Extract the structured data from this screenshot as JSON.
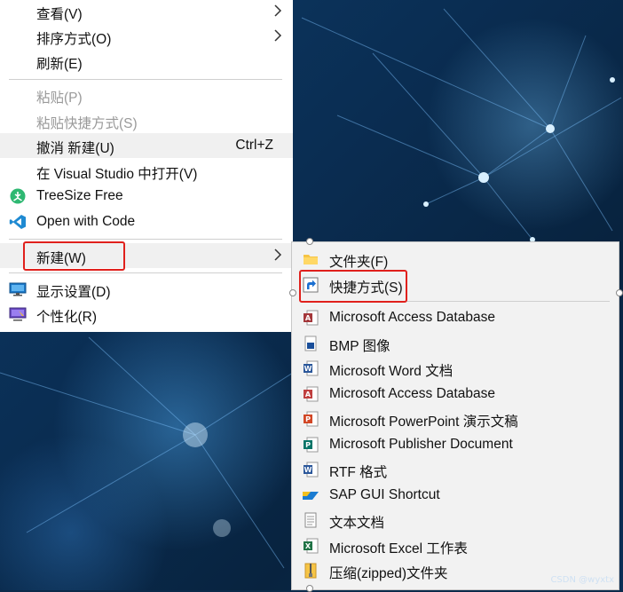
{
  "main_menu": {
    "items": [
      {
        "label": "查看(V)"
      },
      {
        "label": "排序方式(O)"
      },
      {
        "label": "刷新(E)"
      },
      {
        "label": "粘贴(P)"
      },
      {
        "label": "粘贴快捷方式(S)"
      },
      {
        "label": "撤消 新建(U)",
        "shortcut": "Ctrl+Z"
      },
      {
        "label": "在 Visual Studio 中打开(V)"
      },
      {
        "label": "TreeSize Free",
        "icon": "treesize-icon"
      },
      {
        "label": "Open with Code",
        "icon": "vscode-icon"
      },
      {
        "label": "新建(W)"
      },
      {
        "label": "显示设置(D)",
        "icon": "display-icon"
      },
      {
        "label": "个性化(R)",
        "icon": "personalize-icon"
      }
    ]
  },
  "new_submenu": {
    "items": [
      {
        "label": "文件夹(F)",
        "icon": "folder-icon"
      },
      {
        "label": "快捷方式(S)",
        "icon": "shortcut-icon"
      },
      {
        "label": "Microsoft Access Database",
        "icon": "access-icon"
      },
      {
        "label": "BMP 图像",
        "icon": "bmp-icon"
      },
      {
        "label": "Microsoft Word 文档",
        "icon": "word-icon"
      },
      {
        "label": "Microsoft Access Database",
        "icon": "access-icon"
      },
      {
        "label": "Microsoft PowerPoint 演示文稿",
        "icon": "powerpoint-icon"
      },
      {
        "label": "Microsoft Publisher Document",
        "icon": "publisher-icon"
      },
      {
        "label": "RTF 格式",
        "icon": "rtf-icon"
      },
      {
        "label": "SAP GUI Shortcut",
        "icon": "sap-icon"
      },
      {
        "label": "文本文档",
        "icon": "text-document-icon"
      },
      {
        "label": "Microsoft Excel 工作表",
        "icon": "excel-icon"
      },
      {
        "label": "压缩(zipped)文件夹",
        "icon": "zip-folder-icon"
      }
    ]
  },
  "watermark": "CSDN @wyxtx",
  "colors": {
    "highlight": "#e0201c",
    "menu_bg": "#ffffff",
    "submenu_bg": "#f2f2f2"
  }
}
